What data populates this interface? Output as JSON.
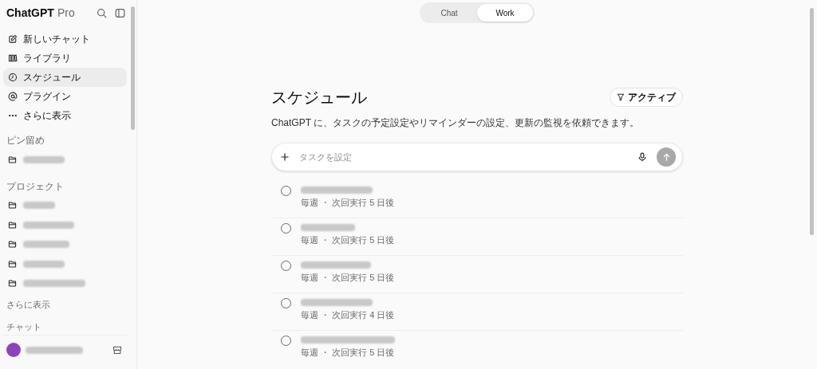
{
  "sidebar": {
    "brand": "ChatGPT",
    "brand_suffix": "Pro",
    "nav": [
      {
        "label": "新しいチャット",
        "selected": false
      },
      {
        "label": "ライブラリ",
        "selected": false
      },
      {
        "label": "スケジュール",
        "selected": true
      },
      {
        "label": "プラグイン",
        "selected": false
      },
      {
        "label": "さらに表示",
        "selected": false
      }
    ],
    "pinned_heading": "ピン留め",
    "pinned": [
      {
        "kind": "redacted"
      }
    ],
    "projects_heading": "プロジェクト",
    "projects": [
      {
        "kind": "redacted"
      },
      {
        "kind": "redacted"
      },
      {
        "kind": "redacted"
      },
      {
        "kind": "redacted"
      },
      {
        "kind": "redacted"
      }
    ],
    "projects_more": "さらに表示",
    "chats_heading": "チャット",
    "user": {
      "kind": "redacted"
    }
  },
  "mode_tabs": [
    {
      "label": "Chat",
      "selected": false
    },
    {
      "label": "Work",
      "selected": true
    }
  ],
  "page": {
    "title": "スケジュール",
    "filter": "アクティブ",
    "description": "ChatGPT に、タスクの予定設定やリマインダーの設定、更新の監視を依頼できます。",
    "input": {
      "placeholder": "タスクを設定"
    },
    "tasks": [
      {
        "kind": "redacted",
        "checked": false,
        "schedule": "毎週 ・ 次回実行 5 日後"
      },
      {
        "kind": "redacted",
        "checked": false,
        "schedule": "毎週 ・ 次回実行 5 日後"
      },
      {
        "kind": "redacted",
        "checked": false,
        "schedule": "毎週 ・ 次回実行 5 日後"
      },
      {
        "kind": "redacted",
        "checked": false,
        "schedule": "毎週 ・ 次回実行 4 日後"
      },
      {
        "kind": "redacted",
        "checked": false,
        "schedule": "毎週 ・ 次回実行 5 日後"
      }
    ]
  }
}
